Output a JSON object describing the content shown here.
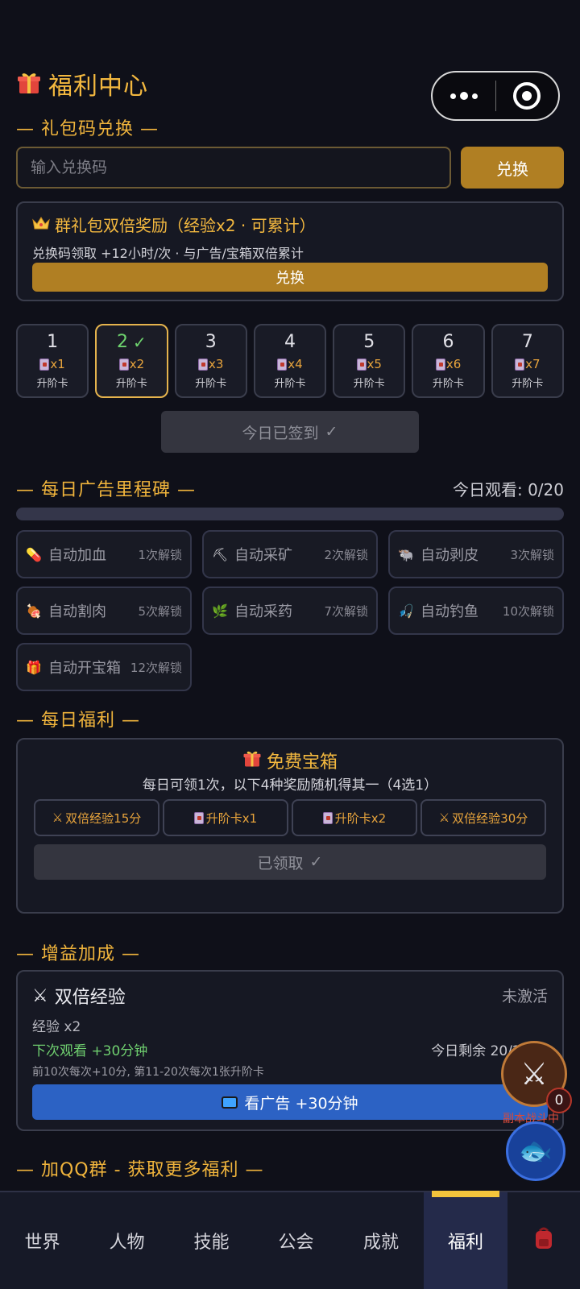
{
  "header": {
    "title": "福利中心"
  },
  "redeem": {
    "section_title": "— 礼包码兑换 —",
    "placeholder": "输入兑换码",
    "button_label": "兑换",
    "group_bonus": {
      "title": "群礼包双倍奖励（经验x2 · 可累计）",
      "subtitle": "兑换码领取 +12小时/次 · 与广告/宝箱双倍累计",
      "button_label": "兑换"
    }
  },
  "signin": {
    "days": [
      {
        "day": "1",
        "reward": "x1",
        "name": "升阶卡",
        "checked": false
      },
      {
        "day": "2",
        "reward": "x2",
        "name": "升阶卡",
        "checked": true
      },
      {
        "day": "3",
        "reward": "x3",
        "name": "升阶卡",
        "checked": false
      },
      {
        "day": "4",
        "reward": "x4",
        "name": "升阶卡",
        "checked": false
      },
      {
        "day": "5",
        "reward": "x5",
        "name": "升阶卡",
        "checked": false
      },
      {
        "day": "6",
        "reward": "x6",
        "name": "升阶卡",
        "checked": false
      },
      {
        "day": "7",
        "reward": "x7",
        "name": "升阶卡",
        "checked": false
      }
    ],
    "status_button": "今日已签到"
  },
  "ad_milestone": {
    "section_title": "— 每日广告里程碑 —",
    "watched_label": "今日观看: 0/20",
    "progress": 0,
    "items": [
      {
        "icon": "pill-icon",
        "glyph": "💊",
        "label": "自动加血",
        "unlock": "1次解锁"
      },
      {
        "icon": "pickaxe-icon",
        "glyph": "⛏",
        "label": "自动采矿",
        "unlock": "2次解锁"
      },
      {
        "icon": "hide-icon",
        "glyph": "🐃",
        "label": "自动剥皮",
        "unlock": "3次解锁"
      },
      {
        "icon": "meat-icon",
        "glyph": "🍖",
        "label": "自动割肉",
        "unlock": "5次解锁"
      },
      {
        "icon": "herb-icon",
        "glyph": "🌿",
        "label": "自动采药",
        "unlock": "7次解锁"
      },
      {
        "icon": "fishing-icon",
        "glyph": "🎣",
        "label": "自动钓鱼",
        "unlock": "10次解锁"
      },
      {
        "icon": "gift-icon",
        "glyph": "🎁",
        "label": "自动开宝箱",
        "unlock": "12次解锁"
      }
    ]
  },
  "daily_welfare": {
    "section_title": "— 每日福利 —",
    "box_title": "免费宝箱",
    "box_subtitle": "每日可领1次，以下4种奖励随机得其一（4选1）",
    "options": [
      {
        "icon": "swords-icon",
        "glyph": "⚔",
        "label": "双倍经验15分"
      },
      {
        "icon": "card-icon",
        "glyph": "",
        "label": "升阶卡x1"
      },
      {
        "icon": "card-icon",
        "glyph": "",
        "label": "升阶卡x2"
      },
      {
        "icon": "swords-icon",
        "glyph": "⚔",
        "label": "双倍经验30分"
      }
    ],
    "claim_status": "已领取"
  },
  "buff": {
    "section_title": "— 增益加成 —",
    "title": "双倍经验",
    "status": "未激活",
    "effect": "经验 x2",
    "next_watch": "下次观看 +30分钟",
    "remaining": "今日剩余 20/20 次",
    "note": "前10次每次+10分, 第11-20次每次1张升阶卡",
    "ad_button": "看广告 +30分钟"
  },
  "qq_group": {
    "section_title": "— 加QQ群 - 获取更多福利 —"
  },
  "floating": {
    "dungeon_label": "副本战斗中",
    "badge_count": "0"
  },
  "tabbar": {
    "tabs": [
      {
        "label": "世界",
        "active": false
      },
      {
        "label": "人物",
        "active": false
      },
      {
        "label": "技能",
        "active": false
      },
      {
        "label": "公会",
        "active": false
      },
      {
        "label": "成就",
        "active": false
      },
      {
        "label": "福利",
        "active": true
      }
    ]
  },
  "colors": {
    "accent": "#f0b43c",
    "button_gold": "#b07f23",
    "ad_blue": "#2c62c4",
    "success": "#6ed36e",
    "background": "#0f1019"
  }
}
